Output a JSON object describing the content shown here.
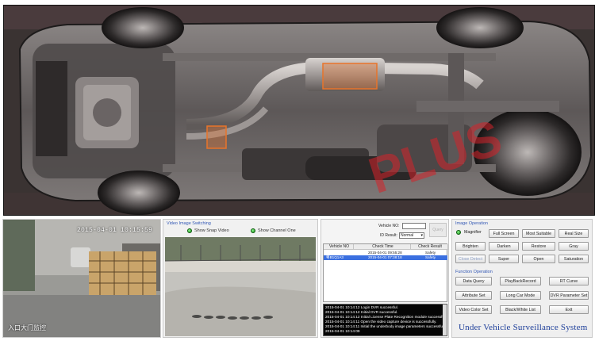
{
  "app": {
    "title": "Under Vehicle Surveillance System"
  },
  "colors": {
    "title": "#1e3f9a",
    "section_header": "#3358b5",
    "selected_row": "#3a6fe0",
    "log_bg": "#050505",
    "highlight_box": "#e8742a",
    "led": "#2fbf2f"
  },
  "scan_view": {
    "watermark": "PLUS"
  },
  "camera_left": {
    "timestamp": "2015-04-01 10:15:59",
    "name": "入口大门监控"
  },
  "video_panel": {
    "header": "Video Image Switching",
    "options": [
      {
        "label": "Show Snap Video",
        "icon": "green-led-icon"
      },
      {
        "label": "Show Channel One",
        "icon": "green-led-icon"
      }
    ]
  },
  "query": {
    "vehicle_no_label": "Vehicle NO:",
    "vehicle_no_value": "",
    "result_label": "ID Result:",
    "result_value": "Normal",
    "query_button": "Query"
  },
  "table": {
    "columns": [
      "Vehicle NO",
      "Check Time",
      "Check Result"
    ],
    "rows": [
      {
        "vehicle_no": "",
        "check_time": "2015-04-01 09:55:28",
        "result": "Safety",
        "selected": false
      },
      {
        "vehicle_no": "粤B1Q1A3",
        "check_time": "2015-04-01 07:38:18",
        "result": "Safety",
        "selected": true
      }
    ]
  },
  "log": [
    "2015-04-01 10:14:12  Login DVR successful.",
    "2015-04-01 10:14:12  Initial DVR successful.",
    "2015-04-01 10:14:12  Initial License Plate Recognition module successful.",
    "2015-04-01 10:14:11  Open the video capture device is successfully.",
    "2015-04-01 10:14:11  Initial the underbody image parameters successfully.",
    "2015-04-01 10:14:09"
  ],
  "image_operation": {
    "header": "Image Operation",
    "magnifier": {
      "label": "Magnifier",
      "icon": "green-led-icon"
    },
    "buttons": [
      {
        "label": "Full Screen",
        "enabled": true
      },
      {
        "label": "Most Suitable",
        "enabled": true
      },
      {
        "label": "Real Size",
        "enabled": true
      },
      {
        "label": "Brighten",
        "enabled": true
      },
      {
        "label": "Darken",
        "enabled": true
      },
      {
        "label": "Restore",
        "enabled": true
      },
      {
        "label": "Gray",
        "enabled": true
      },
      {
        "label": "Close Detect",
        "enabled": false
      },
      {
        "label": "Super",
        "enabled": true
      },
      {
        "label": "Open",
        "enabled": true
      },
      {
        "label": "Saturation",
        "enabled": true
      }
    ]
  },
  "function_operation": {
    "header": "Function Operation",
    "buttons": [
      {
        "label": "Data Query"
      },
      {
        "label": "PlayBackRecord"
      },
      {
        "label": "RT Curve"
      },
      {
        "label": "Attribute Set"
      },
      {
        "label": "Long Car Mode"
      },
      {
        "label": "DVR Parameter Set"
      },
      {
        "label": "Video Color Set"
      },
      {
        "label": "Black/White List"
      },
      {
        "label": "Exit"
      }
    ]
  }
}
